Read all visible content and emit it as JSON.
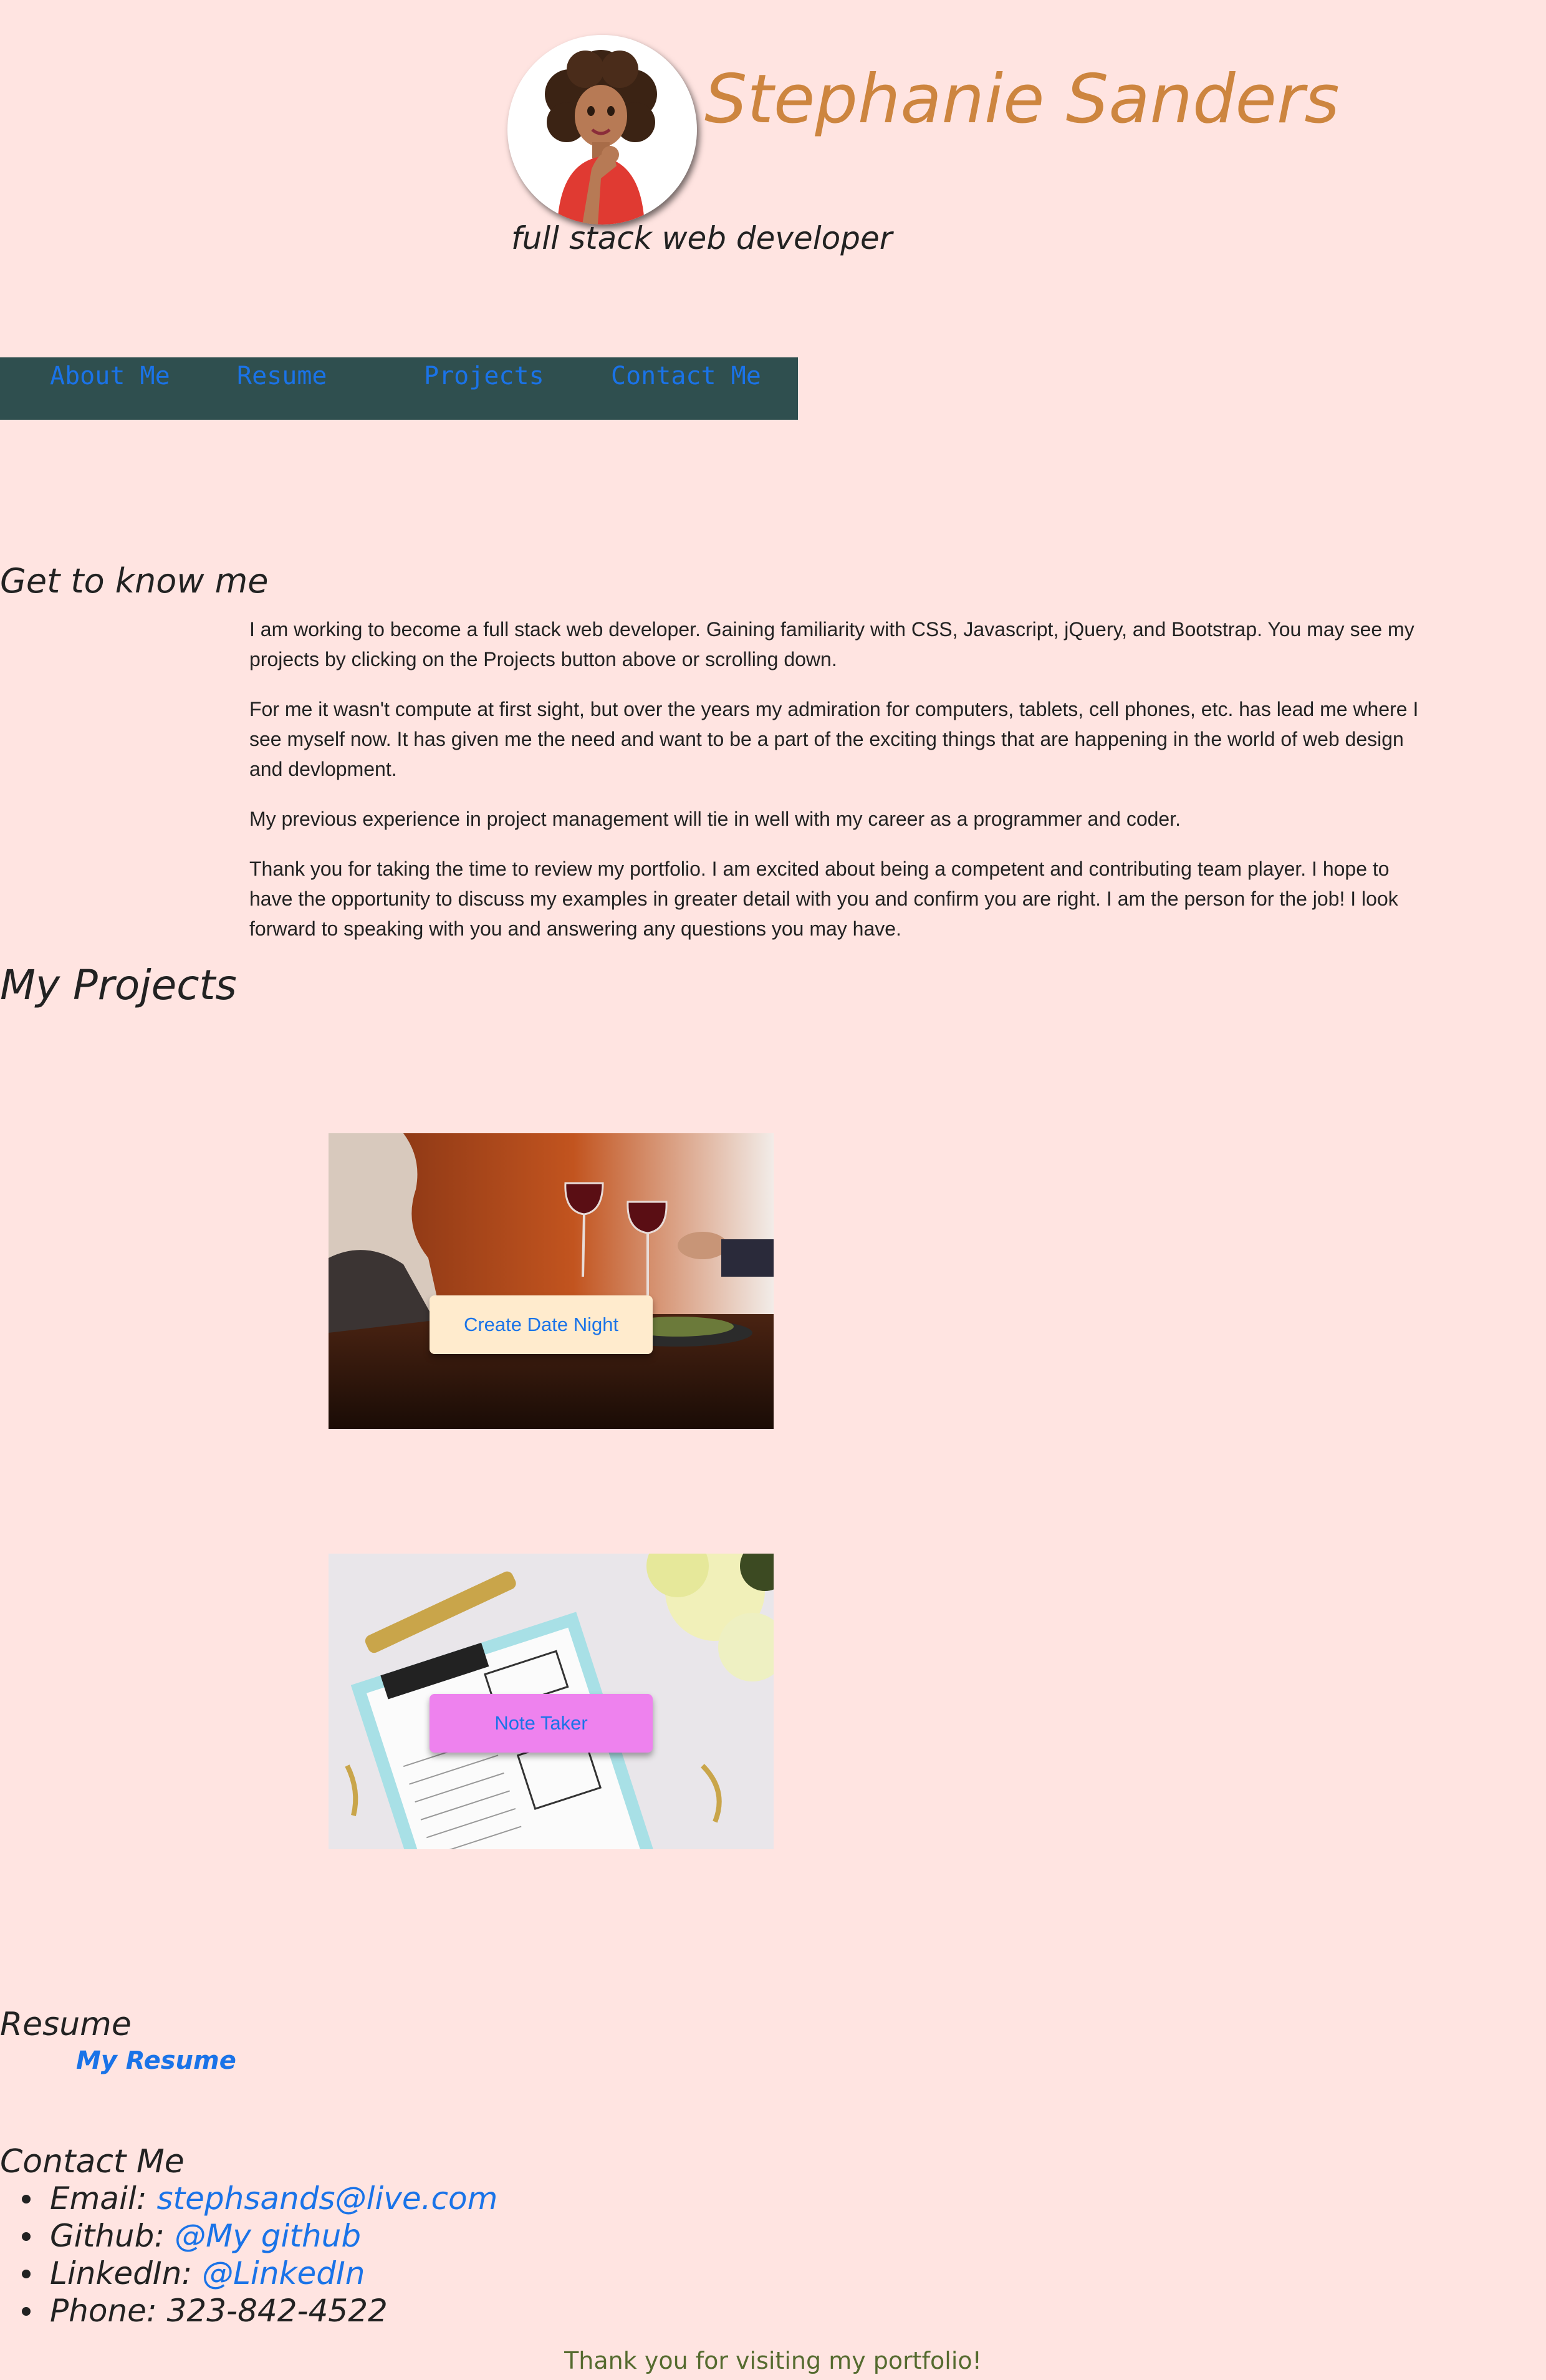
{
  "header": {
    "name": "Stephanie Sanders",
    "tagline": "full stack web developer",
    "avatar_icon": "cartoon-woman-avatar-icon"
  },
  "nav": {
    "items": [
      {
        "label": "About Me"
      },
      {
        "label": "Resume"
      },
      {
        "label": "Projects"
      },
      {
        "label": "Contact Me"
      }
    ]
  },
  "about": {
    "heading": "Get to know me",
    "paragraphs": [
      "I am working to become a full stack web developer. Gaining familiarity with CSS, Javascript, jQuery, and Bootstrap. You may see my projects by clicking on the Projects button above or scrolling down.",
      "For me it wasn't compute at first sight, but over the years my admiration for computers, tablets, cell phones, etc. has lead me where I see myself now. It has given me the need and want to be a part of the exciting things that are happening in the world of web design and devlopment.",
      "My previous experience in project management will tie in well with my career as a programmer and coder.",
      "Thank you for taking the time to review my portfolio. I am excited about being a competent and contributing team player. I hope to have the opportunity to discuss my examples in greater detail with you and confirm you are right. I am the person for the job! I look forward to speaking with you and answering any questions you may have."
    ]
  },
  "projects": {
    "heading": "My Projects",
    "items": [
      {
        "button_label": "Create Date Night",
        "button_color": "#ffebcd"
      },
      {
        "button_label": "Note Taker",
        "button_color": "#ee82ee"
      }
    ]
  },
  "resume": {
    "heading": "Resume",
    "link_label": "My Resume"
  },
  "contact": {
    "heading": "Contact Me",
    "items": [
      {
        "label": "Email: ",
        "link": "stephsands@live.com"
      },
      {
        "label": "Github: ",
        "link": "@My github"
      },
      {
        "label": "LinkedIn: ",
        "link": "@LinkedIn"
      },
      {
        "label": "Phone: 323-842-4522",
        "link": ""
      }
    ]
  },
  "footer": {
    "text": "Thank you for visiting my portfolio!"
  },
  "colors": {
    "page_background": "#ffe4e1",
    "title": "#cd853f",
    "nav_background": "#2f4f4f",
    "link": "#1a73e8",
    "footer_text": "#556b2f"
  }
}
